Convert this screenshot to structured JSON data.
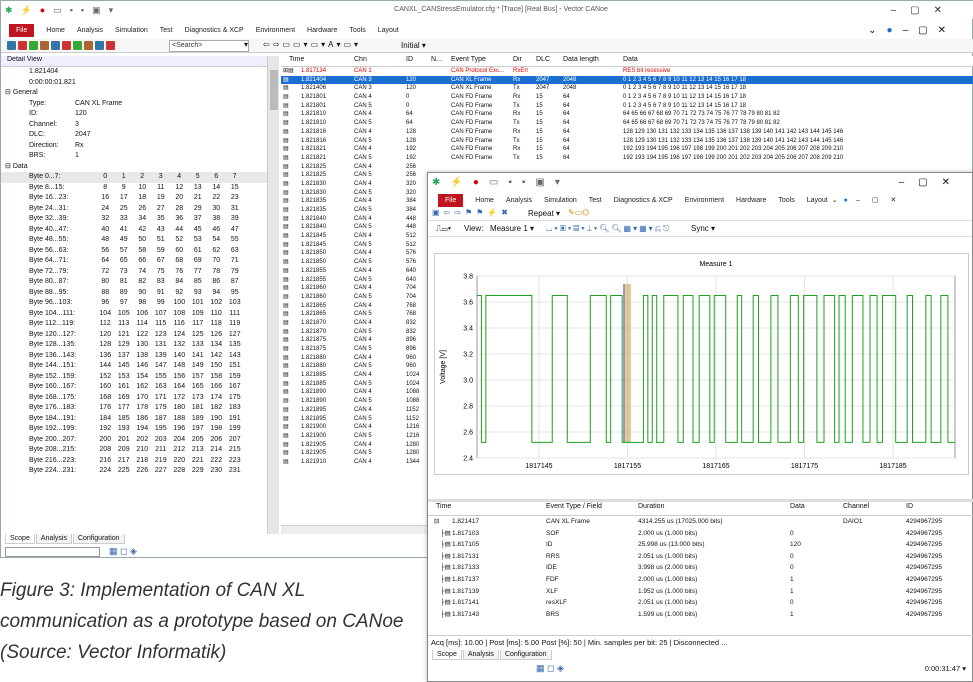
{
  "main": {
    "title": "CANXL_CANStressEmulator.cfg * [Trace] [Real Bus] - Vector CANoe",
    "file_label": "File",
    "tabs": [
      "Home",
      "Analysis",
      "Simulation",
      "Test",
      "Diagnostics & XCP",
      "Environment",
      "Hardware",
      "Tools",
      "Layout"
    ],
    "search_placeholder": "<Search>",
    "initial_label": "Initial",
    "detail": {
      "title": "Detail View",
      "time1": "1.821404",
      "time2": "0:00:00:01.821",
      "general": "General",
      "fields": [
        [
          "Type:",
          "CAN XL Frame"
        ],
        [
          "ID:",
          "120"
        ],
        [
          "Channel:",
          "3"
        ],
        [
          "DLC:",
          "2047"
        ],
        [
          "Direction:",
          "Rx"
        ],
        [
          "BRS:",
          "1"
        ]
      ],
      "data": "Data",
      "byte_rows": [
        [
          "Byte 0...7:",
          "0",
          "1",
          "2",
          "3",
          "4",
          "5",
          "6",
          "7"
        ],
        [
          "Byte 8...15:",
          "8",
          "9",
          "10",
          "11",
          "12",
          "13",
          "14",
          "15"
        ],
        [
          "Byte 16...23:",
          "16",
          "17",
          "18",
          "19",
          "20",
          "21",
          "22",
          "23"
        ],
        [
          "Byte 24...31:",
          "24",
          "25",
          "26",
          "27",
          "28",
          "29",
          "30",
          "31"
        ],
        [
          "Byte 32...39:",
          "32",
          "33",
          "34",
          "35",
          "36",
          "37",
          "38",
          "39"
        ],
        [
          "Byte 40...47:",
          "40",
          "41",
          "42",
          "43",
          "44",
          "45",
          "46",
          "47"
        ],
        [
          "Byte 48...55:",
          "48",
          "49",
          "50",
          "51",
          "52",
          "53",
          "54",
          "55"
        ],
        [
          "Byte 56...63:",
          "56",
          "57",
          "58",
          "59",
          "60",
          "61",
          "62",
          "63"
        ],
        [
          "Byte 64...71:",
          "64",
          "65",
          "66",
          "67",
          "68",
          "69",
          "70",
          "71"
        ],
        [
          "Byte 72...79:",
          "72",
          "73",
          "74",
          "75",
          "76",
          "77",
          "78",
          "79"
        ],
        [
          "Byte 80...87:",
          "80",
          "81",
          "82",
          "83",
          "84",
          "85",
          "86",
          "87"
        ],
        [
          "Byte 88...95:",
          "88",
          "89",
          "90",
          "91",
          "92",
          "93",
          "94",
          "95"
        ],
        [
          "Byte 96...103:",
          "96",
          "97",
          "98",
          "99",
          "100",
          "101",
          "102",
          "103"
        ],
        [
          "Byte 104...111:",
          "104",
          "105",
          "106",
          "107",
          "108",
          "109",
          "110",
          "111"
        ],
        [
          "Byte 112...119:",
          "112",
          "113",
          "114",
          "115",
          "116",
          "117",
          "118",
          "119"
        ],
        [
          "Byte 120...127:",
          "120",
          "121",
          "122",
          "123",
          "124",
          "125",
          "126",
          "127"
        ],
        [
          "Byte 128...135:",
          "128",
          "129",
          "130",
          "131",
          "132",
          "133",
          "134",
          "135"
        ],
        [
          "Byte 136...143:",
          "136",
          "137",
          "138",
          "139",
          "140",
          "141",
          "142",
          "143"
        ],
        [
          "Byte 144...151:",
          "144",
          "145",
          "146",
          "147",
          "148",
          "149",
          "150",
          "151"
        ],
        [
          "Byte 152...159:",
          "152",
          "153",
          "154",
          "155",
          "156",
          "157",
          "158",
          "159"
        ],
        [
          "Byte 160...167:",
          "160",
          "161",
          "162",
          "163",
          "164",
          "165",
          "166",
          "167"
        ],
        [
          "Byte 168...175:",
          "168",
          "169",
          "170",
          "171",
          "172",
          "173",
          "174",
          "175"
        ],
        [
          "Byte 176...183:",
          "176",
          "177",
          "178",
          "179",
          "180",
          "181",
          "182",
          "183"
        ],
        [
          "Byte 184...191:",
          "184",
          "185",
          "186",
          "187",
          "188",
          "189",
          "190",
          "191"
        ],
        [
          "Byte 192...199:",
          "192",
          "193",
          "194",
          "195",
          "196",
          "197",
          "198",
          "199"
        ],
        [
          "Byte 200...207:",
          "200",
          "201",
          "202",
          "203",
          "204",
          "205",
          "206",
          "207"
        ],
        [
          "Byte 208...215:",
          "208",
          "209",
          "210",
          "211",
          "212",
          "213",
          "214",
          "215"
        ],
        [
          "Byte 216...223:",
          "216",
          "217",
          "218",
          "219",
          "220",
          "221",
          "222",
          "223"
        ],
        [
          "Byte 224...231:",
          "224",
          "225",
          "226",
          "227",
          "228",
          "229",
          "230",
          "231"
        ]
      ],
      "bottom_tabs": [
        "Scope",
        "Analysis",
        "Configuration"
      ]
    },
    "trace": {
      "headers": [
        "Time",
        "Chn",
        "ID",
        "N...",
        "Event Type",
        "Dir",
        "DLC",
        "Data length",
        "Data"
      ],
      "rows": [
        [
          "1.817134",
          "CAN 1",
          "",
          "",
          "CAN Protocol Exc...",
          "RxErr",
          "",
          "",
          "RES bit recessive"
        ],
        [
          "1.821404",
          "CAN 3",
          "120",
          "",
          "CAN XL Frame",
          "Rx",
          "2047",
          "2048",
          "0 1 2 3 4 5 6 7 8 9 10 11 12 13 14 15 16 17 18"
        ],
        [
          "1.821406",
          "CAN 3",
          "120",
          "",
          "CAN XL Frame",
          "Tx",
          "2047",
          "2048",
          "0 1 2 3 4 5 6 7 8 9 10 11 12 13 14 15 16 17 18"
        ],
        [
          "1.821801",
          "CAN 4",
          "0",
          "",
          "CAN FD Frame",
          "Rx",
          "15",
          "64",
          "0 1 2 3 4 5 6 7 8 9 10 11 12 13 14 15 16 17 18"
        ],
        [
          "1.821801",
          "CAN 5",
          "0",
          "",
          "CAN FD Frame",
          "Tx",
          "15",
          "64",
          "0 1 2 3 4 5 6 7 8 9 10 11 12 13 14 15 16 17 18"
        ],
        [
          "1.821810",
          "CAN 4",
          "64",
          "",
          "CAN FD Frame",
          "Rx",
          "15",
          "64",
          "64 65 66 67 68 69 70 71 72 73 74 75 76 77 78 79 80 81 82"
        ],
        [
          "1.821810",
          "CAN 5",
          "64",
          "",
          "CAN FD Frame",
          "Tx",
          "15",
          "64",
          "64 65 66 67 68 69 70 71 72 73 74 75 76 77 78 79 80 81 82"
        ],
        [
          "1.821816",
          "CAN 4",
          "128",
          "",
          "CAN FD Frame",
          "Rx",
          "15",
          "64",
          "128 129 130 131 132 133 134 135 136 137 138 139 140 141 142 143 144 145 146"
        ],
        [
          "1.821816",
          "CAN 5",
          "128",
          "",
          "CAN FD Frame",
          "Tx",
          "15",
          "64",
          "128 129 130 131 132 133 134 135 136 137 138 139 140 141 142 143 144 145 146"
        ],
        [
          "1.821821",
          "CAN 4",
          "192",
          "",
          "CAN FD Frame",
          "Rx",
          "15",
          "64",
          "192 193 194 195 196 197 198 199 200 201 202 203 204 205 206 207 208 209 210"
        ],
        [
          "1.821821",
          "CAN 5",
          "192",
          "",
          "CAN FD Frame",
          "Tx",
          "15",
          "64",
          "192 193 194 195 196 197 198 199 200 201 202 203 204 205 206 207 208 209 210"
        ],
        [
          "1.821825",
          "CAN 4",
          "256",
          "",
          "",
          "",
          "",
          "",
          ""
        ],
        [
          "1.821825",
          "CAN 5",
          "256",
          "",
          "",
          "",
          "",
          "",
          ""
        ],
        [
          "1.821830",
          "CAN 4",
          "320",
          "",
          "",
          "",
          "",
          "",
          ""
        ],
        [
          "1.821830",
          "CAN 5",
          "320",
          "",
          "",
          "",
          "",
          "",
          ""
        ],
        [
          "1.821835",
          "CAN 4",
          "384",
          "",
          "",
          "",
          "",
          "",
          ""
        ],
        [
          "1.821835",
          "CAN 5",
          "384",
          "",
          "",
          "",
          "",
          "",
          ""
        ],
        [
          "1.821840",
          "CAN 4",
          "448",
          "",
          "",
          "",
          "",
          "",
          ""
        ],
        [
          "1.821840",
          "CAN 5",
          "448",
          "",
          "",
          "",
          "",
          "",
          ""
        ],
        [
          "1.821845",
          "CAN 4",
          "512",
          "",
          "",
          "",
          "",
          "",
          ""
        ],
        [
          "1.821845",
          "CAN 5",
          "512",
          "",
          "",
          "",
          "",
          "",
          ""
        ],
        [
          "1.821850",
          "CAN 4",
          "576",
          "",
          "",
          "",
          "",
          "",
          ""
        ],
        [
          "1.821850",
          "CAN 5",
          "576",
          "",
          "",
          "",
          "",
          "",
          ""
        ],
        [
          "1.821855",
          "CAN 4",
          "640",
          "",
          "",
          "",
          "",
          "",
          ""
        ],
        [
          "1.821855",
          "CAN 5",
          "640",
          "",
          "",
          "",
          "",
          "",
          ""
        ],
        [
          "1.821860",
          "CAN 4",
          "704",
          "",
          "",
          "",
          "",
          "",
          ""
        ],
        [
          "1.821860",
          "CAN 5",
          "704",
          "",
          "",
          "",
          "",
          "",
          ""
        ],
        [
          "1.821865",
          "CAN 4",
          "768",
          "",
          "",
          "",
          "",
          "",
          ""
        ],
        [
          "1.821865",
          "CAN 5",
          "768",
          "",
          "",
          "",
          "",
          "",
          ""
        ],
        [
          "1.821870",
          "CAN 4",
          "832",
          "",
          "",
          "",
          "",
          "",
          ""
        ],
        [
          "1.821870",
          "CAN 5",
          "832",
          "",
          "",
          "",
          "",
          "",
          ""
        ],
        [
          "1.821875",
          "CAN 4",
          "896",
          "",
          "",
          "",
          "",
          "",
          ""
        ],
        [
          "1.821875",
          "CAN 5",
          "896",
          "",
          "",
          "",
          "",
          "",
          ""
        ],
        [
          "1.821880",
          "CAN 4",
          "960",
          "",
          "",
          "",
          "",
          "",
          ""
        ],
        [
          "1.821880",
          "CAN 5",
          "960",
          "",
          "",
          "",
          "",
          "",
          ""
        ],
        [
          "1.821885",
          "CAN 4",
          "1024",
          "",
          "",
          "",
          "",
          "",
          ""
        ],
        [
          "1.821885",
          "CAN 5",
          "1024",
          "",
          "",
          "",
          "",
          "",
          ""
        ],
        [
          "1.821890",
          "CAN 4",
          "1088",
          "",
          "",
          "",
          "",
          "",
          ""
        ],
        [
          "1.821890",
          "CAN 5",
          "1088",
          "",
          "",
          "",
          "",
          "",
          ""
        ],
        [
          "1.821895",
          "CAN 4",
          "1152",
          "",
          "",
          "",
          "",
          "",
          ""
        ],
        [
          "1.821895",
          "CAN 5",
          "1152",
          "",
          "",
          "",
          "",
          "",
          ""
        ],
        [
          "1.821900",
          "CAN 4",
          "1216",
          "",
          "",
          "",
          "",
          "",
          ""
        ],
        [
          "1.821900",
          "CAN 5",
          "1216",
          "",
          "",
          "",
          "",
          "",
          ""
        ],
        [
          "1.821905",
          "CAN 4",
          "1280",
          "",
          "",
          "",
          "",
          "",
          ""
        ],
        [
          "1.821905",
          "CAN 5",
          "1280",
          "",
          "",
          "",
          "",
          "",
          ""
        ],
        [
          "1.821910",
          "CAN 4",
          "1344",
          "",
          "",
          "",
          "",
          "",
          ""
        ]
      ]
    }
  },
  "scope": {
    "file_label": "File",
    "tabs": [
      "Home",
      "Analysis",
      "Simulation",
      "Test",
      "Diagnostics & XCP",
      "Environment",
      "Hardware",
      "Tools",
      "Layout"
    ],
    "repeat_label": "Repeat",
    "view_label": "View:",
    "measure_label": "Measure 1",
    "sync_label": "Sync",
    "chart_title": "Measure 1",
    "ylabel": "Voltage [V]",
    "table_headers": [
      "Time",
      "Event Type / Field",
      "Duration",
      "Data",
      "Channel",
      "ID"
    ],
    "table_rows": [
      [
        "1.821417",
        "CAN XL Frame",
        "4314.255 us (17025.000 bits)",
        "",
        "DAIO1",
        "4294967295"
      ],
      [
        "1.817103",
        "SOF",
        "2.000 us (1.000 bits)",
        "0",
        "",
        "4294967295"
      ],
      [
        "1.817105",
        "ID",
        "25.998 us (13.000 bits)",
        "120",
        "",
        "4294967295"
      ],
      [
        "1.817131",
        "RRS",
        "2.051 us (1.000 bits)",
        "0",
        "",
        "4294967295"
      ],
      [
        "1.817133",
        "IDE",
        "3.998 us (2.000 bits)",
        "0",
        "",
        "4294967295"
      ],
      [
        "1.817137",
        "FDF",
        "2.000 us (1.000 bits)",
        "1",
        "",
        "4294967295"
      ],
      [
        "1.817139",
        "XLF",
        "1.952 us (1.000 bits)",
        "1",
        "",
        "4294967295"
      ],
      [
        "1.817141",
        "resXLF",
        "2.051 us (1.000 bits)",
        "0",
        "",
        "4294967295"
      ],
      [
        "1.817143",
        "BRS",
        "1.599 us (1.000 bits)",
        "1",
        "",
        "4294967295"
      ]
    ],
    "status": "Acq [ms]: 10.00 | Post [ms]: 5.00 Post [%]: 50 | Min. samples per bit: 25 | Disconnected ...",
    "bottom_tabs": [
      "Scope",
      "Analysis",
      "Configuration"
    ],
    "clock": "0:00:31:47"
  },
  "caption": "Figure 3: Implementation of CAN XL communication as a prototype based on CANoe (Source: Vector Informatik)",
  "chart_data": {
    "type": "line",
    "title": "Measure 1",
    "xlabel": "",
    "ylabel": "Voltage [V]",
    "x_ticks": [
      "1817145",
      "1817155",
      "1817165",
      "1817175",
      "1817185"
    ],
    "y_ticks": [
      "2.4",
      "2.6",
      "2.8",
      "3.0",
      "3.2",
      "3.4",
      "3.6",
      "3.8"
    ],
    "ylim": [
      2.4,
      3.8
    ],
    "xlim": [
      1817138,
      1817192
    ],
    "high": 3.65,
    "low": 2.52,
    "transitions": [
      1817138.5,
      1817139,
      1817144.2,
      1817146.5,
      1817148.2,
      1817150.8,
      1817152.6,
      1817153.1,
      1817154.4,
      1817156.8,
      1817157.3,
      1817157.8,
      1817158.3,
      1817159.1,
      1817160.7,
      1817161.3,
      1817162.4,
      1817163.1,
      1817164.3,
      1817164.8,
      1817166.1,
      1817167.4,
      1817167.9,
      1817169.2,
      1817169.8,
      1817171.2,
      1817172.0,
      1817173.4,
      1817174.3,
      1817174.9,
      1817176.4,
      1817177.2,
      1817178.4,
      1817178.9,
      1817179.6,
      1817180.4,
      1817181.6,
      1817182.4,
      1817183.2,
      1817183.8,
      1817185.3,
      1817186.6,
      1817187.2,
      1817188.7,
      1817189.3,
      1817190.4,
      1817191.2
    ],
    "line_color": "#1fa020",
    "marker_x": [
      1817154.6,
      1817155.4
    ]
  }
}
